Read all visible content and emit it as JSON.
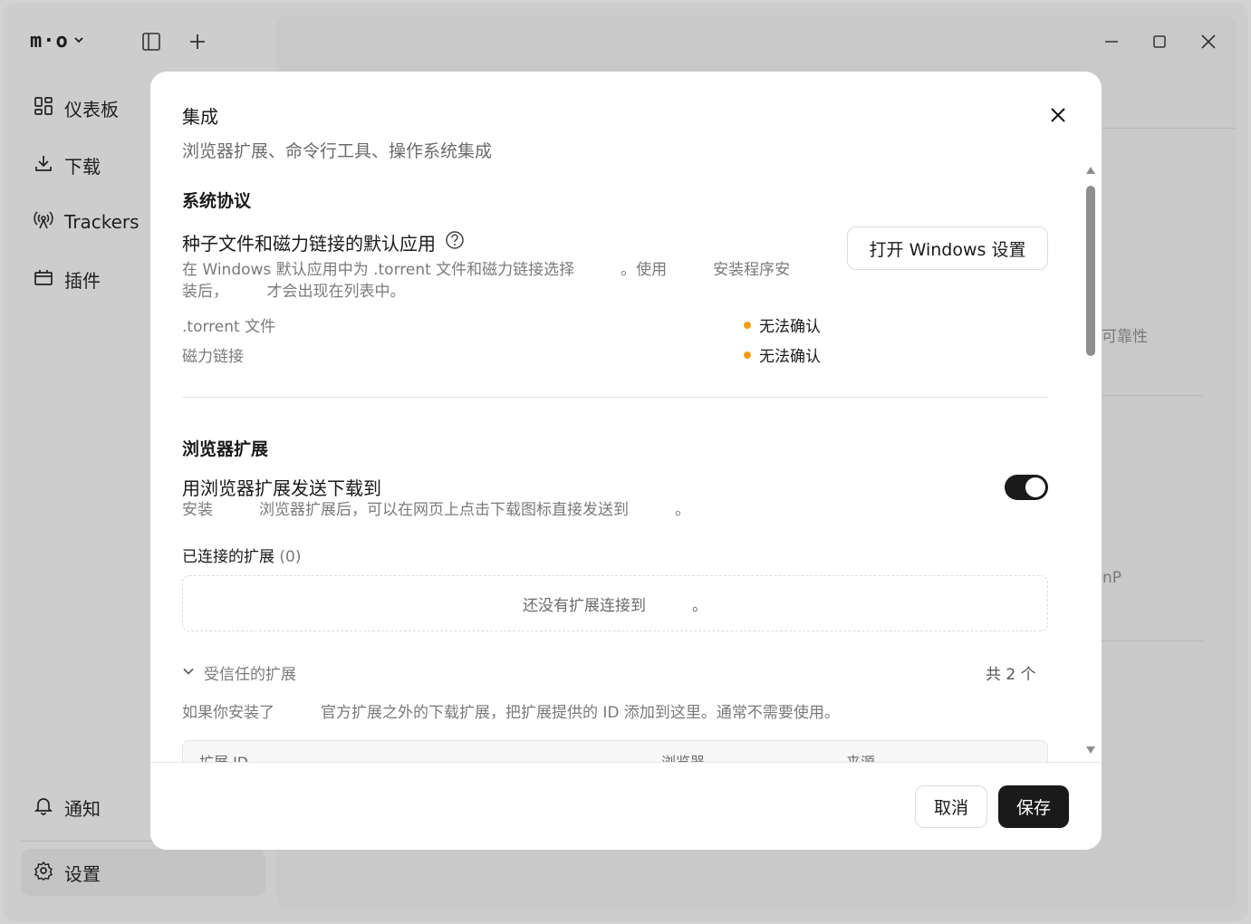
{
  "app": {
    "logo": "m·o"
  },
  "sidebar": {
    "items": [
      {
        "label": "仪表板",
        "icon": "dashboard-icon"
      },
      {
        "label": "下载",
        "icon": "download-icon"
      },
      {
        "label": "Trackers",
        "icon": "antenna-icon"
      },
      {
        "label": "插件",
        "icon": "plugin-icon"
      }
    ],
    "bottom": [
      {
        "label": "通知",
        "icon": "bell-icon"
      },
      {
        "label": "设置",
        "icon": "gear-icon"
      }
    ]
  },
  "background": {
    "text_reliability": "可靠性",
    "text_np": "nP"
  },
  "dialog": {
    "title": "集成",
    "subtitle": "浏览器扩展、命令行工具、操作系统集成",
    "system_protocol": {
      "heading": "系统协议",
      "item_title": "种子文件和磁力链接的默认应用",
      "desc_line1": "在 Windows 默认应用中为 .torrent 文件和磁力链接选择　　　。使用　　　安装程序安",
      "desc_line2": "装后，　　　才会出现在列表中。",
      "open_settings_button": "打开 Windows 设置",
      "rows": [
        {
          "label": ".torrent 文件",
          "status": "无法确认"
        },
        {
          "label": "磁力链接",
          "status": "无法确认"
        }
      ]
    },
    "browser_extension": {
      "heading": "浏览器扩展",
      "item_title": "用浏览器扩展发送下载到",
      "desc": "安装　　　浏览器扩展后，可以在网页上点击下载图标直接发送到　　　。",
      "toggle_on": true,
      "connected_label": "已连接的扩展",
      "connected_count": "(0)",
      "empty_text": "还没有扩展连接到　　　。",
      "trusted_label": "受信任的扩展",
      "trusted_count": "共 2 个",
      "trusted_desc": "如果你安装了　　　官方扩展之外的下载扩展，把扩展提供的 ID 添加到这里。通常不需要使用。",
      "table_headers": [
        "扩展 ID",
        "浏览器",
        "来源"
      ]
    },
    "footer": {
      "cancel": "取消",
      "save": "保存"
    }
  }
}
